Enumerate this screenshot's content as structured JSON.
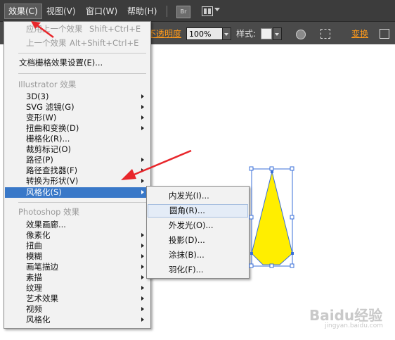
{
  "menubar": {
    "items": [
      {
        "label": "效果(C)",
        "active": true
      },
      {
        "label": "视图(V)"
      },
      {
        "label": "窗口(W)"
      },
      {
        "label": "帮助(H)"
      }
    ],
    "bridge_badge": "Br"
  },
  "controlbar": {
    "opacity_label": "不透明度",
    "opacity_value": "100%",
    "style_label": "样式:",
    "transform_label": "变换"
  },
  "effect_menu": {
    "top_items": [
      {
        "label": "应用上一个效果",
        "shortcut": "Shift+Ctrl+E",
        "disabled": true
      },
      {
        "label": "上一个效果",
        "shortcut": "Alt+Shift+Ctrl+E",
        "disabled": true
      }
    ],
    "doc_raster_settings": "文档栅格效果设置(E)...",
    "illustrator_section": "Illustrator 效果",
    "illustrator_items": [
      {
        "label": "3D(3)",
        "submenu": true
      },
      {
        "label": "SVG 滤镜(G)",
        "submenu": true
      },
      {
        "label": "变形(W)",
        "submenu": true
      },
      {
        "label": "扭曲和变换(D)",
        "submenu": true
      },
      {
        "label": "栅格化(R)...",
        "submenu": false
      },
      {
        "label": "裁剪标记(O)",
        "submenu": false
      },
      {
        "label": "路径(P)",
        "submenu": true
      },
      {
        "label": "路径查找器(F)",
        "submenu": true
      },
      {
        "label": "转换为形状(V)",
        "submenu": true
      },
      {
        "label": "风格化(S)",
        "submenu": true,
        "highlighted": true
      }
    ],
    "photoshop_section": "Photoshop 效果",
    "photoshop_items": [
      {
        "label": "效果画廊...",
        "submenu": false
      },
      {
        "label": "像素化",
        "submenu": true
      },
      {
        "label": "扭曲",
        "submenu": true
      },
      {
        "label": "模糊",
        "submenu": true
      },
      {
        "label": "画笔描边",
        "submenu": true
      },
      {
        "label": "素描",
        "submenu": true
      },
      {
        "label": "纹理",
        "submenu": true
      },
      {
        "label": "艺术效果",
        "submenu": true
      },
      {
        "label": "视频",
        "submenu": true
      },
      {
        "label": "风格化",
        "submenu": true
      }
    ]
  },
  "stylize_submenu": {
    "items": [
      {
        "label": "内发光(I)..."
      },
      {
        "label": "圆角(R)...",
        "selected": true
      },
      {
        "label": "外发光(O)..."
      },
      {
        "label": "投影(D)..."
      },
      {
        "label": "涂抹(B)..."
      },
      {
        "label": "羽化(F)..."
      }
    ]
  },
  "colors": {
    "menubar_bg": "#3c3c3c",
    "menu_highlight": "#3978c8",
    "shape_fill": "#ffee00",
    "annotation_arrow": "#e8262b",
    "selection_handles": "#3a6fd8"
  },
  "watermark": {
    "brand": "Baidu经验",
    "url": "jingyan.baidu.com"
  }
}
